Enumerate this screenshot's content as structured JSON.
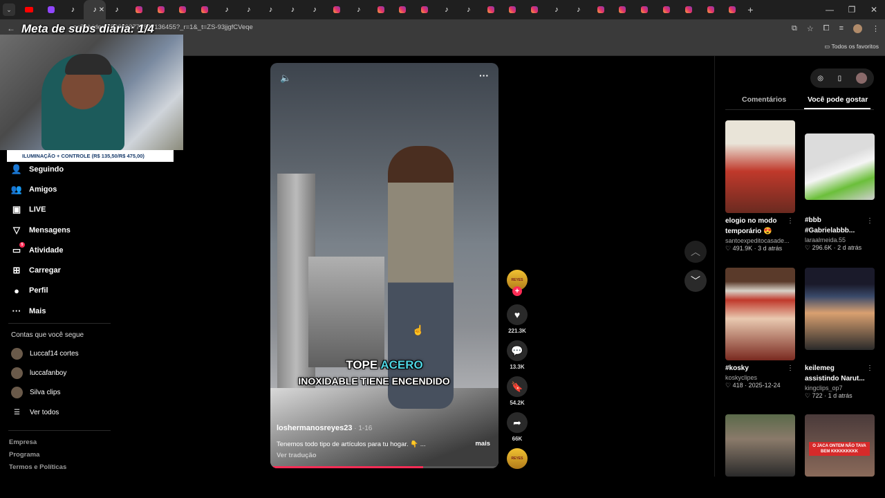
{
  "browser": {
    "tabs": [
      "youtube",
      "twitch",
      "tiktok",
      "tiktok",
      "tiktok",
      "instagram",
      "instagram",
      "instagram",
      "instagram",
      "tiktok",
      "tiktok",
      "tiktok",
      "tiktok",
      "tiktok",
      "instagram",
      "tiktok",
      "instagram",
      "instagram",
      "instagram",
      "tiktok",
      "tiktok",
      "instagram",
      "instagram",
      "instagram",
      "tiktok",
      "tiktok",
      "instagram",
      "instagram",
      "instagram",
      "instagram",
      "instagram",
      "instagram",
      "instagram"
    ],
    "active_tab_index": 3,
    "url": "...es23/video/7596093775840136455?_r=1&_t=ZS-93jjgfCVeqe",
    "bookmarks_all": "Todos os favoritos",
    "profile_initial": "L"
  },
  "overlay": {
    "goal_text": "Meta de subs diária: 1/4",
    "banner_text": "ILUMINAÇÃO + CONTROLE (R$ 135,50/R$ 475,00)"
  },
  "sidebar": {
    "items": [
      {
        "label": "Seguindo",
        "icon": "following-icon"
      },
      {
        "label": "Amigos",
        "icon": "friends-icon"
      },
      {
        "label": "LIVE",
        "icon": "live-icon"
      },
      {
        "label": "Mensagens",
        "icon": "messages-icon"
      },
      {
        "label": "Atividade",
        "icon": "activity-icon",
        "badge": "5"
      },
      {
        "label": "Carregar",
        "icon": "upload-icon"
      },
      {
        "label": "Perfil",
        "icon": "profile-icon"
      },
      {
        "label": "Mais",
        "icon": "more-icon"
      }
    ],
    "following_title": "Contas que você segue",
    "following": [
      "Luccaf14 cortes",
      "luccafanboy",
      "Silva clips"
    ],
    "see_all": "Ver todos",
    "footer": [
      "Empresa",
      "Programa",
      "Termos e Políticas"
    ]
  },
  "video": {
    "caption_line1_a": "TOPE ",
    "caption_line1_b": "ACERO",
    "caption_line2": "INOXIDABLE TIENE ENCENDIDO",
    "author": "loshermanosreyes23",
    "date": " · 1-16",
    "description": "Tenemos todo tipo de artículos para tu hogar. 👇 ...",
    "more": "mais",
    "translate": "Ver tradução",
    "progress": 0.67
  },
  "actions": {
    "likes": "221.3K",
    "comments": "13.3K",
    "saves": "54.2K",
    "shares": "66K",
    "avatar_text": "REYES"
  },
  "panel": {
    "tab_comments": "Comentários",
    "tab_suggested": "Você pode gostar",
    "cards": [
      {
        "title": "elogio no modo temporário 😍",
        "user": "santoexpeditocasade...",
        "stats": "♡ 491.9K · 3 d atrás"
      },
      {
        "title": "#bbb #Gabrielabbb...",
        "user": "laraalmeida.55",
        "stats": "♡ 296.6K · 2 d atrás"
      },
      {
        "title": "#kosky",
        "user": "koskyclipes",
        "stats": "♡ 418 · 2025-12-24"
      },
      {
        "title": "keilemeg assistindo Narut...",
        "user": "kingclips_op7",
        "stats": "♡ 722 · 1 d atrás"
      },
      {
        "title": "",
        "user": "",
        "stats": "",
        "overlay": ""
      },
      {
        "title": "",
        "user": "",
        "stats": "",
        "overlay": "O JACA ONTEM NÃO TAVA BEM KKKKKKKKK"
      }
    ]
  },
  "colors": {
    "accent": "#fe2c55",
    "caption_accent": "#4ed3e0"
  }
}
